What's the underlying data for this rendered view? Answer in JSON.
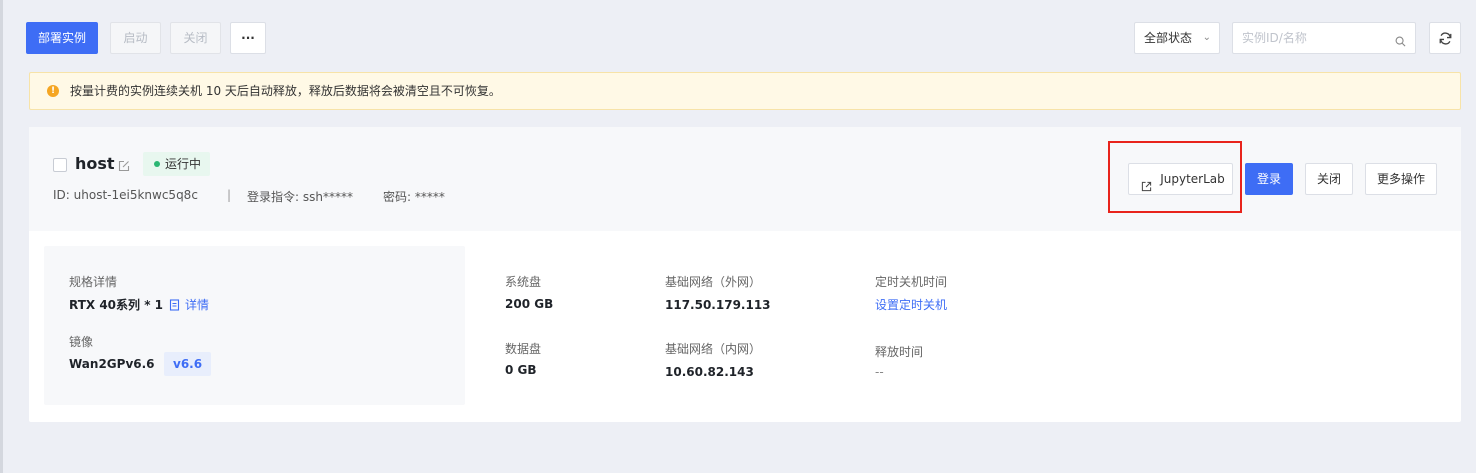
{
  "toolbar": {
    "deploy_label": "部署实例",
    "start_label": "启动",
    "stop_label": "关闭",
    "more_label": "···",
    "status_filter": "全部状态",
    "search_placeholder": "实例ID/名称"
  },
  "notice": {
    "text": "按量计费的实例连续关机 10 天后自动释放，释放后数据将会被清空且不可恢复。"
  },
  "instance": {
    "name": "host",
    "status": "运行中",
    "id_text": "ID: uhost-1ei5knwc5q8c",
    "separator": "|",
    "login_cmd_text": "登录指令: ssh*****",
    "password_text": "密码: *****",
    "actions": {
      "jupyterlab": "JupyterLab",
      "login": "登录",
      "close": "关闭",
      "more": "更多操作"
    },
    "spec": {
      "label": "规格详情",
      "value": "RTX 40系列 * 1",
      "detail_link": "详情"
    },
    "image": {
      "label": "镜像",
      "value": "Wan2GPv6.6",
      "tag": "v6.6"
    },
    "system_disk": {
      "label": "系统盘",
      "value": "200 GB"
    },
    "data_disk": {
      "label": "数据盘",
      "value": "0 GB"
    },
    "public_net": {
      "label": "基础网络（外网）",
      "value": "117.50.179.113"
    },
    "private_net": {
      "label": "基础网络（内网）",
      "value": "10.60.82.143"
    },
    "shutdown_time": {
      "label": "定时关机时间",
      "link": "设置定时关机"
    },
    "release_time": {
      "label": "释放时间",
      "value": "--"
    }
  },
  "colors": {
    "primary": "#3e6df5",
    "running": "#2bb673",
    "warning": "#f5a623",
    "highlight": "#e8231c"
  }
}
